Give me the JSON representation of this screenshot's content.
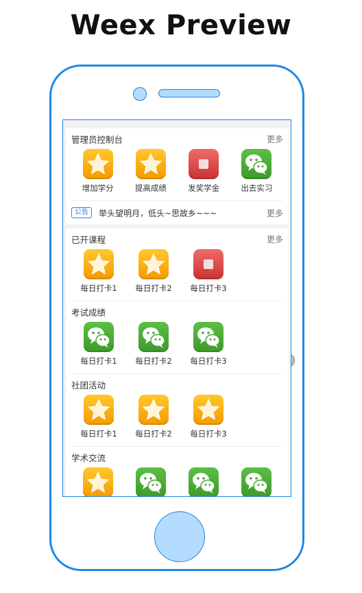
{
  "page_title": "Weex Preview",
  "colors": {
    "frame": "#1e88e5",
    "accent": "#1e88e5",
    "star_icon": "#f5a300",
    "stop_icon": "#d84040",
    "wechat_icon": "#49a834"
  },
  "admin": {
    "title": "管理员控制台",
    "more": "更多",
    "items": [
      {
        "label": "增加学分",
        "icon": "star-icon"
      },
      {
        "label": "提高成绩",
        "icon": "star-icon"
      },
      {
        "label": "发奖学金",
        "icon": "stop-icon"
      },
      {
        "label": "出去实习",
        "icon": "wechat-icon"
      }
    ],
    "notice": {
      "badge": "公告",
      "text": "举头望明月，低头~思故乡~~~",
      "more": "更多"
    }
  },
  "courses": {
    "title": "已开课程",
    "more": "更多",
    "items": [
      {
        "label": "每日打卡1",
        "icon": "star-icon"
      },
      {
        "label": "每日打卡2",
        "icon": "star-icon"
      },
      {
        "label": "每日打卡3",
        "icon": "stop-icon"
      }
    ]
  },
  "exams": {
    "title": "考试成绩",
    "items": [
      {
        "label": "每日打卡1",
        "icon": "wechat-icon"
      },
      {
        "label": "每日打卡2",
        "icon": "wechat-icon"
      },
      {
        "label": "每日打卡3",
        "icon": "wechat-icon"
      }
    ]
  },
  "clubs": {
    "title": "社团活动",
    "items": [
      {
        "label": "每日打卡1",
        "icon": "star-icon"
      },
      {
        "label": "每日打卡2",
        "icon": "star-icon"
      },
      {
        "label": "每日打卡3",
        "icon": "star-icon"
      }
    ]
  },
  "academic": {
    "title": "学术交流",
    "items": [
      {
        "icon": "star-icon"
      },
      {
        "icon": "wechat-icon"
      },
      {
        "icon": "wechat-icon"
      },
      {
        "icon": "wechat-icon"
      }
    ]
  }
}
